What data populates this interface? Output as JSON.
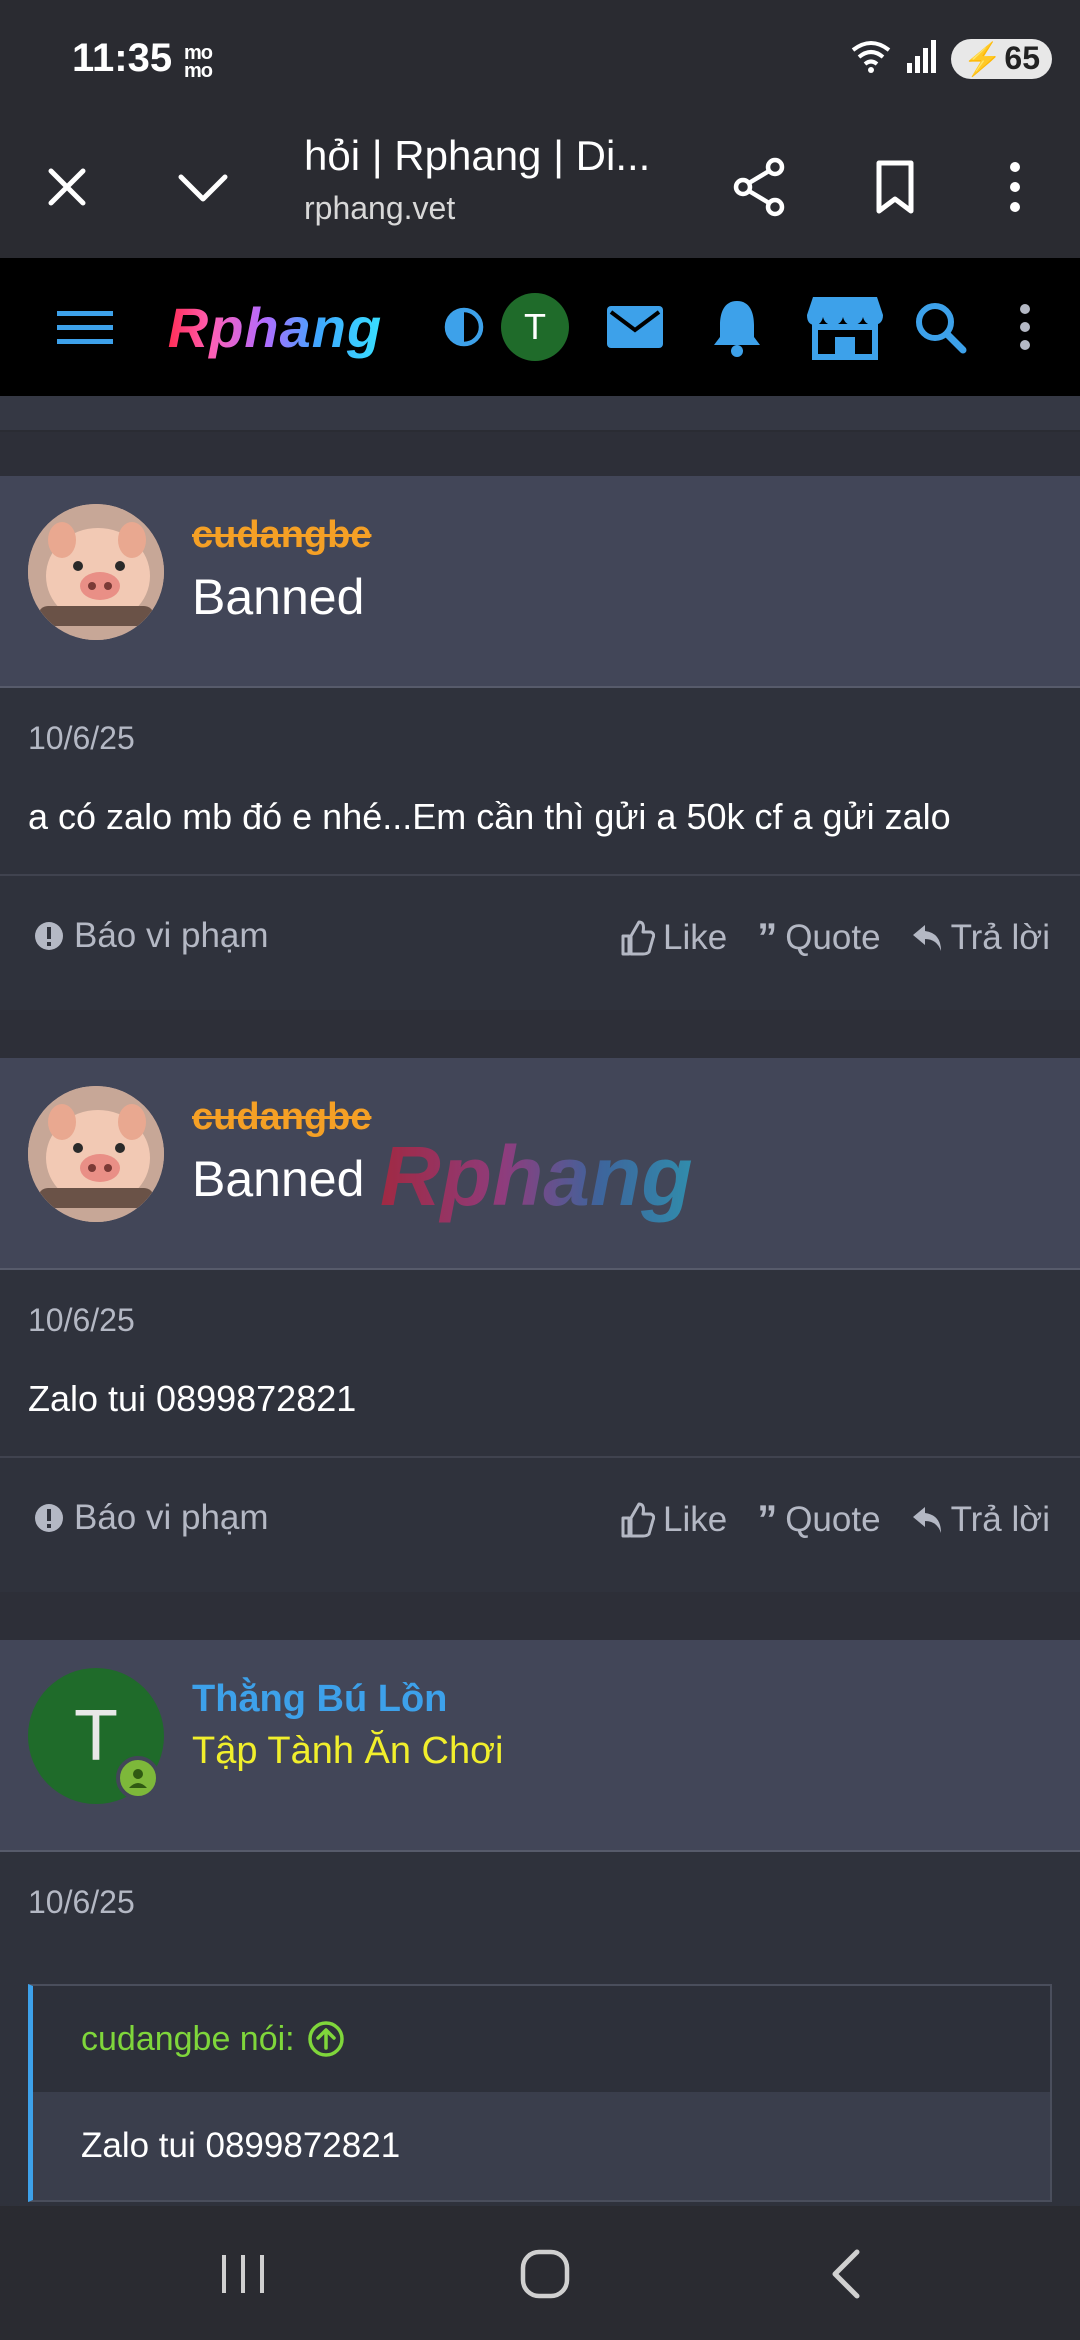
{
  "status": {
    "time": "11:35",
    "carrier_icon": "mo mo",
    "battery": "65"
  },
  "browser": {
    "title": "hỏi | Rphang | Di...",
    "url": "rphang.vet"
  },
  "site": {
    "logo": "Rphang",
    "user_initial": "T"
  },
  "posts": [
    {
      "username": "cudangbe",
      "user_title": "Banned",
      "date": "10/6/25",
      "text": "a có zalo mb đó e nhé...Em cần thì gửi a 50k cf a gửi zalo",
      "report": "Báo vi phạm",
      "like": "Like",
      "quote": "Quote",
      "reply": "Trả lời"
    },
    {
      "username": "cudangbe",
      "user_title": "Banned",
      "watermark": "Rphang",
      "date": "10/6/25",
      "text": "Zalo tui 0899872821",
      "report": "Báo vi phạm",
      "like": "Like",
      "quote": "Quote",
      "reply": "Trả lời"
    },
    {
      "username": "Thằng Bú Lồn",
      "user_title": "Tập Tành Ăn Chơi",
      "avatar_initial": "T",
      "date": "10/6/25",
      "quote_author": "cudangbe nói:",
      "quote_text": "Zalo tui 0899872821"
    }
  ],
  "colors": {
    "banned_name": "#f5a025",
    "member_name": "#3da1ea",
    "member_title": "#f1ef2c",
    "accent": "#3da1ea",
    "quote_author": "#7fd63b"
  }
}
